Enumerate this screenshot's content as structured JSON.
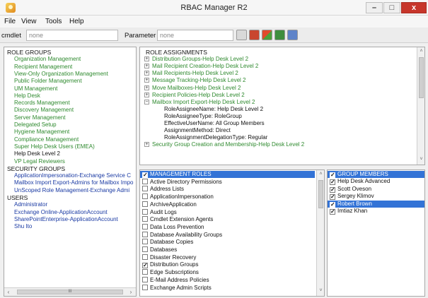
{
  "window": {
    "title": "RBAC Manager R2",
    "min": "–",
    "max": "□",
    "close": "x"
  },
  "menu": [
    "File",
    "View",
    "Tools",
    "Help"
  ],
  "toolbar": {
    "cmdlet_label": "cmdlet",
    "cmdlet_value": "none",
    "parameter_label": "Parameter",
    "parameter_value": "none"
  },
  "left_tree": {
    "sections": [
      {
        "title": "ROLE GROUPS",
        "color": "green",
        "items": [
          "Organization Management",
          "Recipient Management",
          "View-Only Organization Management",
          "Public Folder Management",
          "UM Management",
          "Help Desk",
          "Records Management",
          "Discovery Management",
          "Server Management",
          "Delegated Setup",
          "Hygiene Management",
          "Compliance Management",
          "Super Help Desk Users (EMEA)"
        ]
      },
      {
        "title": "",
        "color": "black",
        "items": [
          "Help Desk Level 2"
        ]
      },
      {
        "title": "",
        "color": "green",
        "items": [
          "VP Legal Reviewers"
        ]
      },
      {
        "title": "SECURITY GROUPS",
        "color": "blue",
        "items": [
          "ApplicationImpersonation-Exchange Service C",
          "Mailbox Import Export-Admins for Mailbox Impo",
          "UnScoped Role Management-Exchange Admi"
        ]
      },
      {
        "title": "USERS",
        "color": "blue",
        "items": [
          "Administrator",
          "Exchange Online-ApplicationAccount",
          "SharePointEnterprise-ApplicationAccount",
          "Shu Ito"
        ]
      }
    ],
    "scroll_mark": "III"
  },
  "role_assignments": {
    "title": "ROLE ASSIGNMENTS",
    "items": [
      "Distribution Groups-Help Desk Level 2",
      "Mail Recipient Creation-Help Desk Level 2",
      "Mail Recipients-Help Desk Level 2",
      "Message Tracking-Help Desk Level 2",
      "Move Mailboxes-Help Desk Level 2",
      "Recipient Policies-Help Desk Level 2",
      "Mailbox Import Export-Help Desk Level 2"
    ],
    "expanded_details": [
      "RoleAssigneeName: Help Desk Level 2",
      "RoleAssigneeType: RoleGroup",
      "EffectiveUserName: All Group Members",
      "AssignmentMethod: Direct",
      "RoleAssignmentDelegationType: Regular"
    ],
    "last_item": "Security Group Creation and Membership-Help Desk Level 2"
  },
  "management_roles": {
    "title": "MANAGEMENT ROLES",
    "items": [
      {
        "label": "Active Directory Permissions",
        "checked": false
      },
      {
        "label": "Address Lists",
        "checked": false
      },
      {
        "label": "ApplicationImpersonation",
        "checked": false
      },
      {
        "label": "ArchiveApplication",
        "checked": false
      },
      {
        "label": "Audit Logs",
        "checked": false
      },
      {
        "label": "Cmdlet Extension Agents",
        "checked": false
      },
      {
        "label": "Data Loss Prevention",
        "checked": false
      },
      {
        "label": "Database Availability Groups",
        "checked": false
      },
      {
        "label": "Database Copies",
        "checked": false
      },
      {
        "label": "Databases",
        "checked": false
      },
      {
        "label": "Disaster Recovery",
        "checked": false
      },
      {
        "label": "Distribution Groups",
        "checked": true
      },
      {
        "label": "Edge Subscriptions",
        "checked": false
      },
      {
        "label": "E-Mail Address Policies",
        "checked": false
      },
      {
        "label": "Exchange Admin Scripts",
        "checked": false
      }
    ]
  },
  "group_members": {
    "title": "GROUP MEMBERS",
    "items": [
      {
        "label": "Help Desk Advanced",
        "checked": true,
        "selected": false
      },
      {
        "label": "Scott Oveson",
        "checked": true,
        "selected": false
      },
      {
        "label": "Sergey Klimov",
        "checked": true,
        "selected": false
      },
      {
        "label": "Robert Brown",
        "checked": true,
        "selected": true
      },
      {
        "label": "Imtiaz Khan",
        "checked": true,
        "selected": false
      }
    ]
  },
  "glyphs": {
    "check": "✓",
    "expand": "+",
    "collapse": "−",
    "left": "‹",
    "right": "›",
    "up": "˄",
    "down": "˅"
  }
}
